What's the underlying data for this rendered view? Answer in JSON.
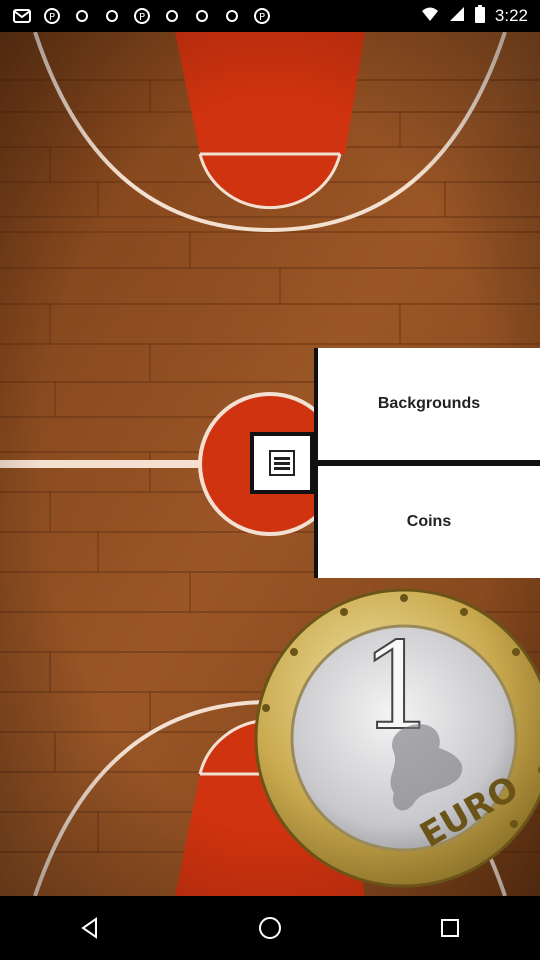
{
  "status_bar": {
    "time": "3:22",
    "notification_icons": [
      "mail-icon",
      "pinterest-icon",
      "sync-icon",
      "sync-icon",
      "pinterest-icon",
      "sync-icon",
      "sync-icon",
      "sync-icon",
      "pinterest-icon"
    ],
    "system_icons": [
      "wifi-icon",
      "signal-icon",
      "battery-icon"
    ]
  },
  "menu": {
    "items": [
      {
        "label": "Backgrounds",
        "name": "menu-item-backgrounds"
      },
      {
        "label": "Coins",
        "name": "menu-item-coins"
      }
    ],
    "toggle_icon": "menu-icon"
  },
  "coin": {
    "denomination": "1",
    "label": "EURO"
  },
  "colors": {
    "wood": "#8a4a1f",
    "paint": "#d0330f",
    "line": "#ffffff",
    "menu_bg": "#ffffff",
    "menu_border": "#111111"
  },
  "nav_bar": {
    "buttons": [
      "back-icon",
      "home-icon",
      "recents-icon"
    ]
  }
}
